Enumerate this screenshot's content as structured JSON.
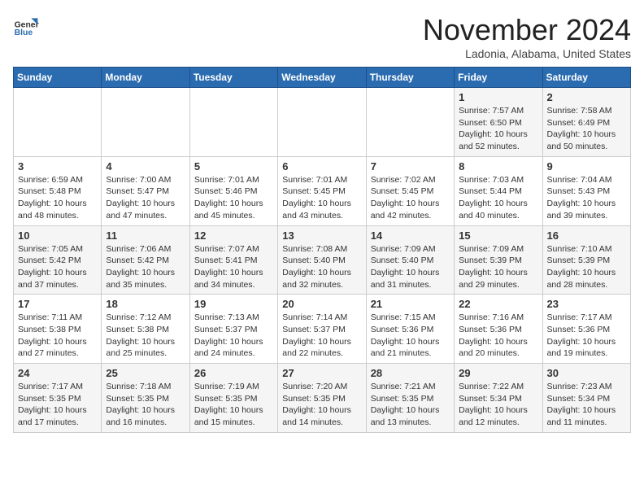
{
  "logo": {
    "general": "General",
    "blue": "Blue"
  },
  "header": {
    "month_year": "November 2024",
    "location": "Ladonia, Alabama, United States"
  },
  "weekdays": [
    "Sunday",
    "Monday",
    "Tuesday",
    "Wednesday",
    "Thursday",
    "Friday",
    "Saturday"
  ],
  "weeks": [
    [
      {
        "day": "",
        "info": ""
      },
      {
        "day": "",
        "info": ""
      },
      {
        "day": "",
        "info": ""
      },
      {
        "day": "",
        "info": ""
      },
      {
        "day": "",
        "info": ""
      },
      {
        "day": "1",
        "info": "Sunrise: 7:57 AM\nSunset: 6:50 PM\nDaylight: 10 hours and 52 minutes."
      },
      {
        "day": "2",
        "info": "Sunrise: 7:58 AM\nSunset: 6:49 PM\nDaylight: 10 hours and 50 minutes."
      }
    ],
    [
      {
        "day": "3",
        "info": "Sunrise: 6:59 AM\nSunset: 5:48 PM\nDaylight: 10 hours and 48 minutes."
      },
      {
        "day": "4",
        "info": "Sunrise: 7:00 AM\nSunset: 5:47 PM\nDaylight: 10 hours and 47 minutes."
      },
      {
        "day": "5",
        "info": "Sunrise: 7:01 AM\nSunset: 5:46 PM\nDaylight: 10 hours and 45 minutes."
      },
      {
        "day": "6",
        "info": "Sunrise: 7:01 AM\nSunset: 5:45 PM\nDaylight: 10 hours and 43 minutes."
      },
      {
        "day": "7",
        "info": "Sunrise: 7:02 AM\nSunset: 5:45 PM\nDaylight: 10 hours and 42 minutes."
      },
      {
        "day": "8",
        "info": "Sunrise: 7:03 AM\nSunset: 5:44 PM\nDaylight: 10 hours and 40 minutes."
      },
      {
        "day": "9",
        "info": "Sunrise: 7:04 AM\nSunset: 5:43 PM\nDaylight: 10 hours and 39 minutes."
      }
    ],
    [
      {
        "day": "10",
        "info": "Sunrise: 7:05 AM\nSunset: 5:42 PM\nDaylight: 10 hours and 37 minutes."
      },
      {
        "day": "11",
        "info": "Sunrise: 7:06 AM\nSunset: 5:42 PM\nDaylight: 10 hours and 35 minutes."
      },
      {
        "day": "12",
        "info": "Sunrise: 7:07 AM\nSunset: 5:41 PM\nDaylight: 10 hours and 34 minutes."
      },
      {
        "day": "13",
        "info": "Sunrise: 7:08 AM\nSunset: 5:40 PM\nDaylight: 10 hours and 32 minutes."
      },
      {
        "day": "14",
        "info": "Sunrise: 7:09 AM\nSunset: 5:40 PM\nDaylight: 10 hours and 31 minutes."
      },
      {
        "day": "15",
        "info": "Sunrise: 7:09 AM\nSunset: 5:39 PM\nDaylight: 10 hours and 29 minutes."
      },
      {
        "day": "16",
        "info": "Sunrise: 7:10 AM\nSunset: 5:39 PM\nDaylight: 10 hours and 28 minutes."
      }
    ],
    [
      {
        "day": "17",
        "info": "Sunrise: 7:11 AM\nSunset: 5:38 PM\nDaylight: 10 hours and 27 minutes."
      },
      {
        "day": "18",
        "info": "Sunrise: 7:12 AM\nSunset: 5:38 PM\nDaylight: 10 hours and 25 minutes."
      },
      {
        "day": "19",
        "info": "Sunrise: 7:13 AM\nSunset: 5:37 PM\nDaylight: 10 hours and 24 minutes."
      },
      {
        "day": "20",
        "info": "Sunrise: 7:14 AM\nSunset: 5:37 PM\nDaylight: 10 hours and 22 minutes."
      },
      {
        "day": "21",
        "info": "Sunrise: 7:15 AM\nSunset: 5:36 PM\nDaylight: 10 hours and 21 minutes."
      },
      {
        "day": "22",
        "info": "Sunrise: 7:16 AM\nSunset: 5:36 PM\nDaylight: 10 hours and 20 minutes."
      },
      {
        "day": "23",
        "info": "Sunrise: 7:17 AM\nSunset: 5:36 PM\nDaylight: 10 hours and 19 minutes."
      }
    ],
    [
      {
        "day": "24",
        "info": "Sunrise: 7:17 AM\nSunset: 5:35 PM\nDaylight: 10 hours and 17 minutes."
      },
      {
        "day": "25",
        "info": "Sunrise: 7:18 AM\nSunset: 5:35 PM\nDaylight: 10 hours and 16 minutes."
      },
      {
        "day": "26",
        "info": "Sunrise: 7:19 AM\nSunset: 5:35 PM\nDaylight: 10 hours and 15 minutes."
      },
      {
        "day": "27",
        "info": "Sunrise: 7:20 AM\nSunset: 5:35 PM\nDaylight: 10 hours and 14 minutes."
      },
      {
        "day": "28",
        "info": "Sunrise: 7:21 AM\nSunset: 5:35 PM\nDaylight: 10 hours and 13 minutes."
      },
      {
        "day": "29",
        "info": "Sunrise: 7:22 AM\nSunset: 5:34 PM\nDaylight: 10 hours and 12 minutes."
      },
      {
        "day": "30",
        "info": "Sunrise: 7:23 AM\nSunset: 5:34 PM\nDaylight: 10 hours and 11 minutes."
      }
    ]
  ]
}
